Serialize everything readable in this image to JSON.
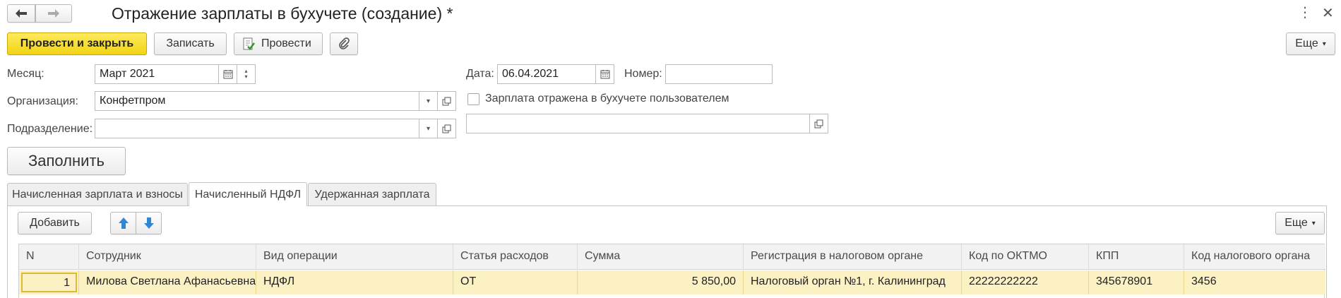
{
  "window": {
    "title": "Отражение зарплаты в бухучете (создание) *",
    "back_icon": "arrow-left-icon",
    "forward_icon": "arrow-right-icon",
    "menu_icon": "more-vertical-icon",
    "close_icon": "close-icon"
  },
  "toolbar": {
    "post_close_label": "Провести и закрыть",
    "save_label": "Записать",
    "post_label": "Провести",
    "more_label": "Еще",
    "accent": "#f5d824"
  },
  "form": {
    "month_label": "Месяц:",
    "month_value": "Март 2021",
    "date_label": "Дата:",
    "date_value": "06.04.2021",
    "number_label": "Номер:",
    "number_value": "",
    "org_label": "Организация:",
    "org_value": "Конфетпром",
    "salary_checkbox_label": "Зарплата отражена в бухучете пользователем",
    "salary_checkbox_checked": false,
    "dept_label": "Подразделение:",
    "dept_value": "",
    "extra_value": "",
    "fill_label": "Заполнить"
  },
  "tabs": [
    {
      "label": "Начисленная зарплата и взносы",
      "active": false
    },
    {
      "label": "Начисленный НДФЛ",
      "active": true
    },
    {
      "label": "Удержанная зарплата",
      "active": false
    }
  ],
  "table_toolbar": {
    "add_label": "Добавить",
    "more_label": "Еще"
  },
  "table": {
    "columns": [
      "N",
      "Сотрудник",
      "Вид операции",
      "Статья расходов",
      "Сумма",
      "Регистрация в налоговом органе",
      "Код по ОКТМО",
      "КПП",
      "Код налогового органа"
    ],
    "rows": [
      [
        "1",
        "Милова Светлана Афанасьевна",
        "НДФЛ",
        "ОТ",
        "5 850,00",
        "Налоговый орган №1, г. Калининград",
        "22222222222",
        "345678901",
        "3456"
      ]
    ],
    "selected_row_color": "#fbf1c3"
  }
}
